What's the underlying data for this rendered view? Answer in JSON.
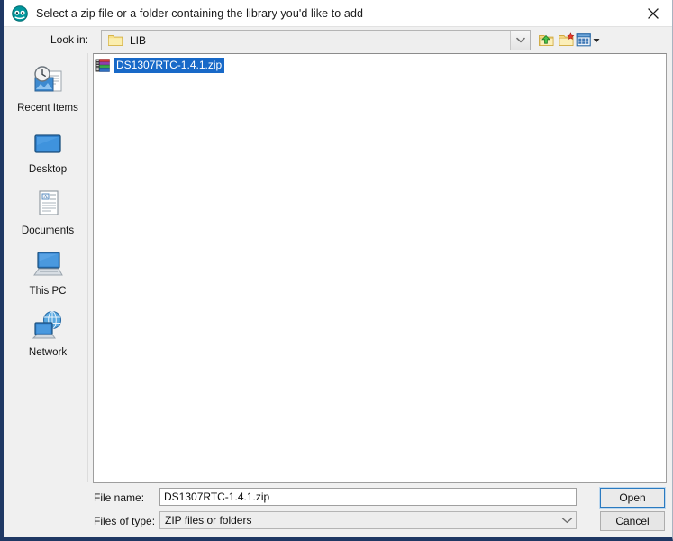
{
  "window": {
    "title": "Select a zip file or a folder containing the library you'd like to add",
    "app_icon": "arduino-logo-icon",
    "close_label": "✕"
  },
  "toolbar": {
    "lookin_label": "Look in:",
    "lookin_value": "LIB",
    "lookin_icon": "folder-icon",
    "up_one_level_icon": "up-one-level-icon",
    "new_folder_icon": "new-folder-icon",
    "view_menu_icon": "view-menu-icon"
  },
  "places": {
    "items": [
      {
        "label": "Recent Items",
        "icon": "recent-items-icon"
      },
      {
        "label": "Desktop",
        "icon": "desktop-icon"
      },
      {
        "label": "Documents",
        "icon": "documents-icon"
      },
      {
        "label": "This PC",
        "icon": "this-pc-icon"
      },
      {
        "label": "Network",
        "icon": "network-icon"
      }
    ]
  },
  "filelist": {
    "items": [
      {
        "name": "DS1307RTC-1.4.1.zip",
        "icon": "zip-archive-icon",
        "selected": true
      }
    ]
  },
  "form": {
    "filename_label": "File name:",
    "filename_value": "DS1307RTC-1.4.1.zip",
    "filename_placeholder": "",
    "filetype_label": "Files of type:",
    "filetype_value": "ZIP files or folders"
  },
  "buttons": {
    "open_label": "Open",
    "cancel_label": "Cancel"
  },
  "colors": {
    "selection_blue": "#1869c8",
    "window_border_navy": "#1f3864",
    "dialog_bg": "#f0f0f0",
    "focus_blue": "#2a7ac0"
  }
}
